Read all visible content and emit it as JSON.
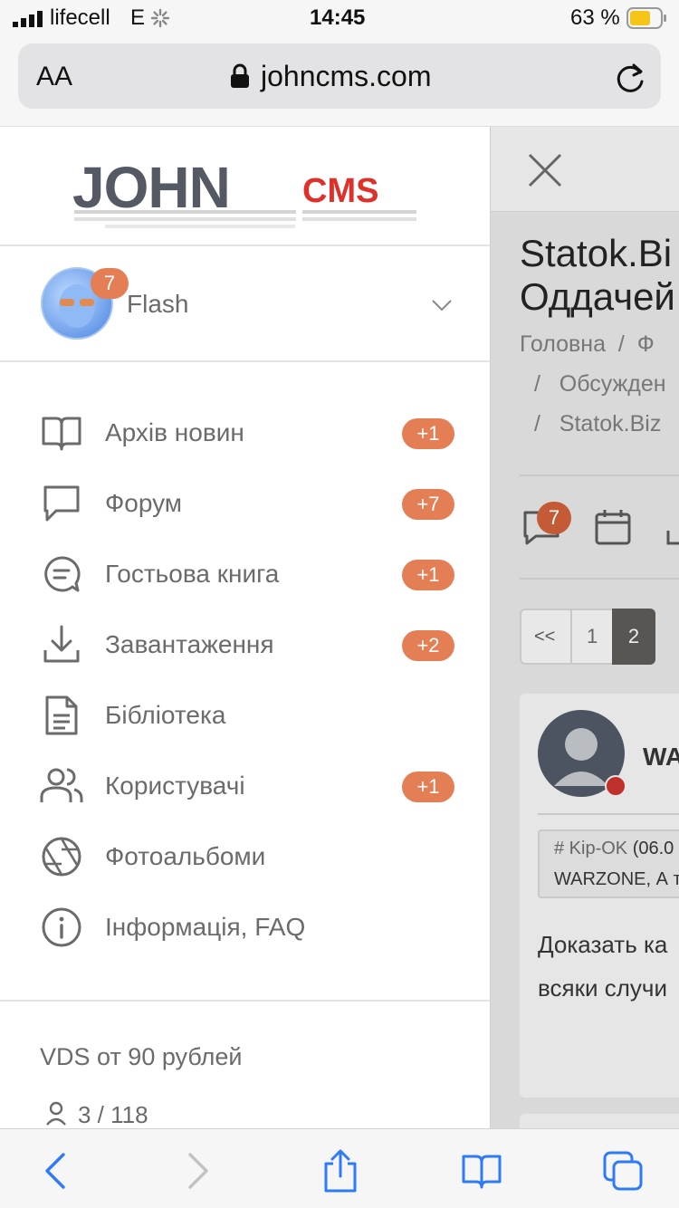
{
  "status_bar": {
    "carrier": "lifecell",
    "network": "E",
    "time": "14:45",
    "battery": "63 %"
  },
  "url_bar": {
    "text_size_label": "AA",
    "url": "johncms.com"
  },
  "drawer": {
    "logo": {
      "main": "JOHN",
      "sub": "CMS"
    },
    "user": {
      "name": "Flash",
      "notifications": "7"
    },
    "menu": [
      {
        "label": "Архів новин",
        "badge": "+1",
        "icon": "book-open-icon"
      },
      {
        "label": "Форум",
        "badge": "+7",
        "icon": "chat-icon"
      },
      {
        "label": "Гостьова книга",
        "badge": "+1",
        "icon": "guestbook-icon"
      },
      {
        "label": "Завантаження",
        "badge": "+2",
        "icon": "download-icon"
      },
      {
        "label": "Бібліотека",
        "badge": "",
        "icon": "document-icon"
      },
      {
        "label": "Користувачі",
        "badge": "+1",
        "icon": "users-icon"
      },
      {
        "label": "Фотоальбоми",
        "badge": "",
        "icon": "camera-aperture-icon"
      },
      {
        "label": "Інформація, FAQ",
        "badge": "",
        "icon": "info-icon"
      }
    ],
    "footer_link": "VDS от 90 рублей",
    "online_count": "3 / 118"
  },
  "page": {
    "title_line1": "Statok.Bi",
    "title_line2": "Оддачей",
    "breadcrumbs": [
      "Головна",
      "Ф",
      "Обсужден",
      "Statok.Biz"
    ],
    "toolbar_badge": "7",
    "pagination": {
      "prev": "<<",
      "pages": [
        "1",
        "2"
      ],
      "current": "2"
    },
    "post": {
      "author": "WA",
      "quote_author": "# Kip-OK",
      "quote_date": "(06.0",
      "quote_text": "WARZONE, А т",
      "body_line1": "Доказать ка",
      "body_line2": "всяки случи"
    }
  },
  "colors": {
    "accent": "#e37e55",
    "brand_dark": "#545964",
    "brand_red": "#e0302a",
    "link_blue": "#2f7bf5"
  }
}
